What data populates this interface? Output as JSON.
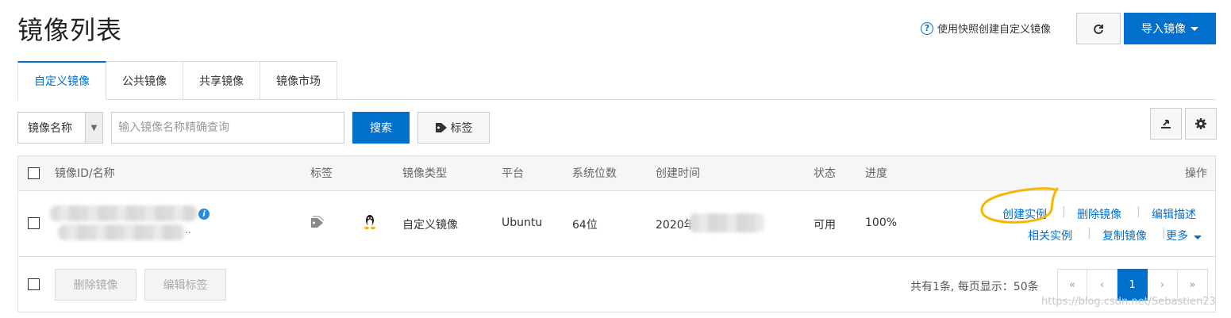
{
  "page": {
    "title": "镜像列表"
  },
  "header": {
    "help_link": "使用快照创建自定义镜像",
    "import_label": "导入镜像"
  },
  "tabs": [
    {
      "label": "自定义镜像",
      "active": true
    },
    {
      "label": "公共镜像",
      "active": false
    },
    {
      "label": "共享镜像",
      "active": false
    },
    {
      "label": "镜像市场",
      "active": false
    }
  ],
  "filter": {
    "field_label": "镜像名称",
    "placeholder": "输入镜像名称精确查询",
    "search_label": "搜索",
    "tag_label": "标签"
  },
  "table": {
    "columns": [
      "镜像ID/名称",
      "标签",
      "镜像类型",
      "平台",
      "系统位数",
      "创建时间",
      "状态",
      "进度",
      "操作"
    ],
    "rows": [
      {
        "id_name": "..",
        "type": "自定义镜像",
        "platform": "Ubuntu",
        "bits": "64位",
        "created": "2020年",
        "status": "可用",
        "progress": "100%",
        "actions": {
          "create_instance": "创建实例",
          "delete_image": "删除镜像",
          "edit_desc": "编辑描述",
          "related_instances": "相关实例",
          "copy_image": "复制镜像",
          "more": "更多"
        }
      }
    ]
  },
  "footer": {
    "delete_label": "删除镜像",
    "edit_tags_label": "编辑标签",
    "summary": "共有1条, 每页显示：50条",
    "pages": {
      "first": "«",
      "prev": "‹",
      "current": "1",
      "next": "›",
      "last": "»"
    }
  },
  "watermark": "https://blog.csdn.net/Sebastien23",
  "colors": {
    "primary": "#0070cc",
    "highlight": "#f5b800"
  },
  "icons": [
    "help-icon",
    "refresh-icon",
    "caret-down-icon",
    "tag-icon",
    "export-icon",
    "gear-icon",
    "info-icon",
    "linux-icon"
  ]
}
